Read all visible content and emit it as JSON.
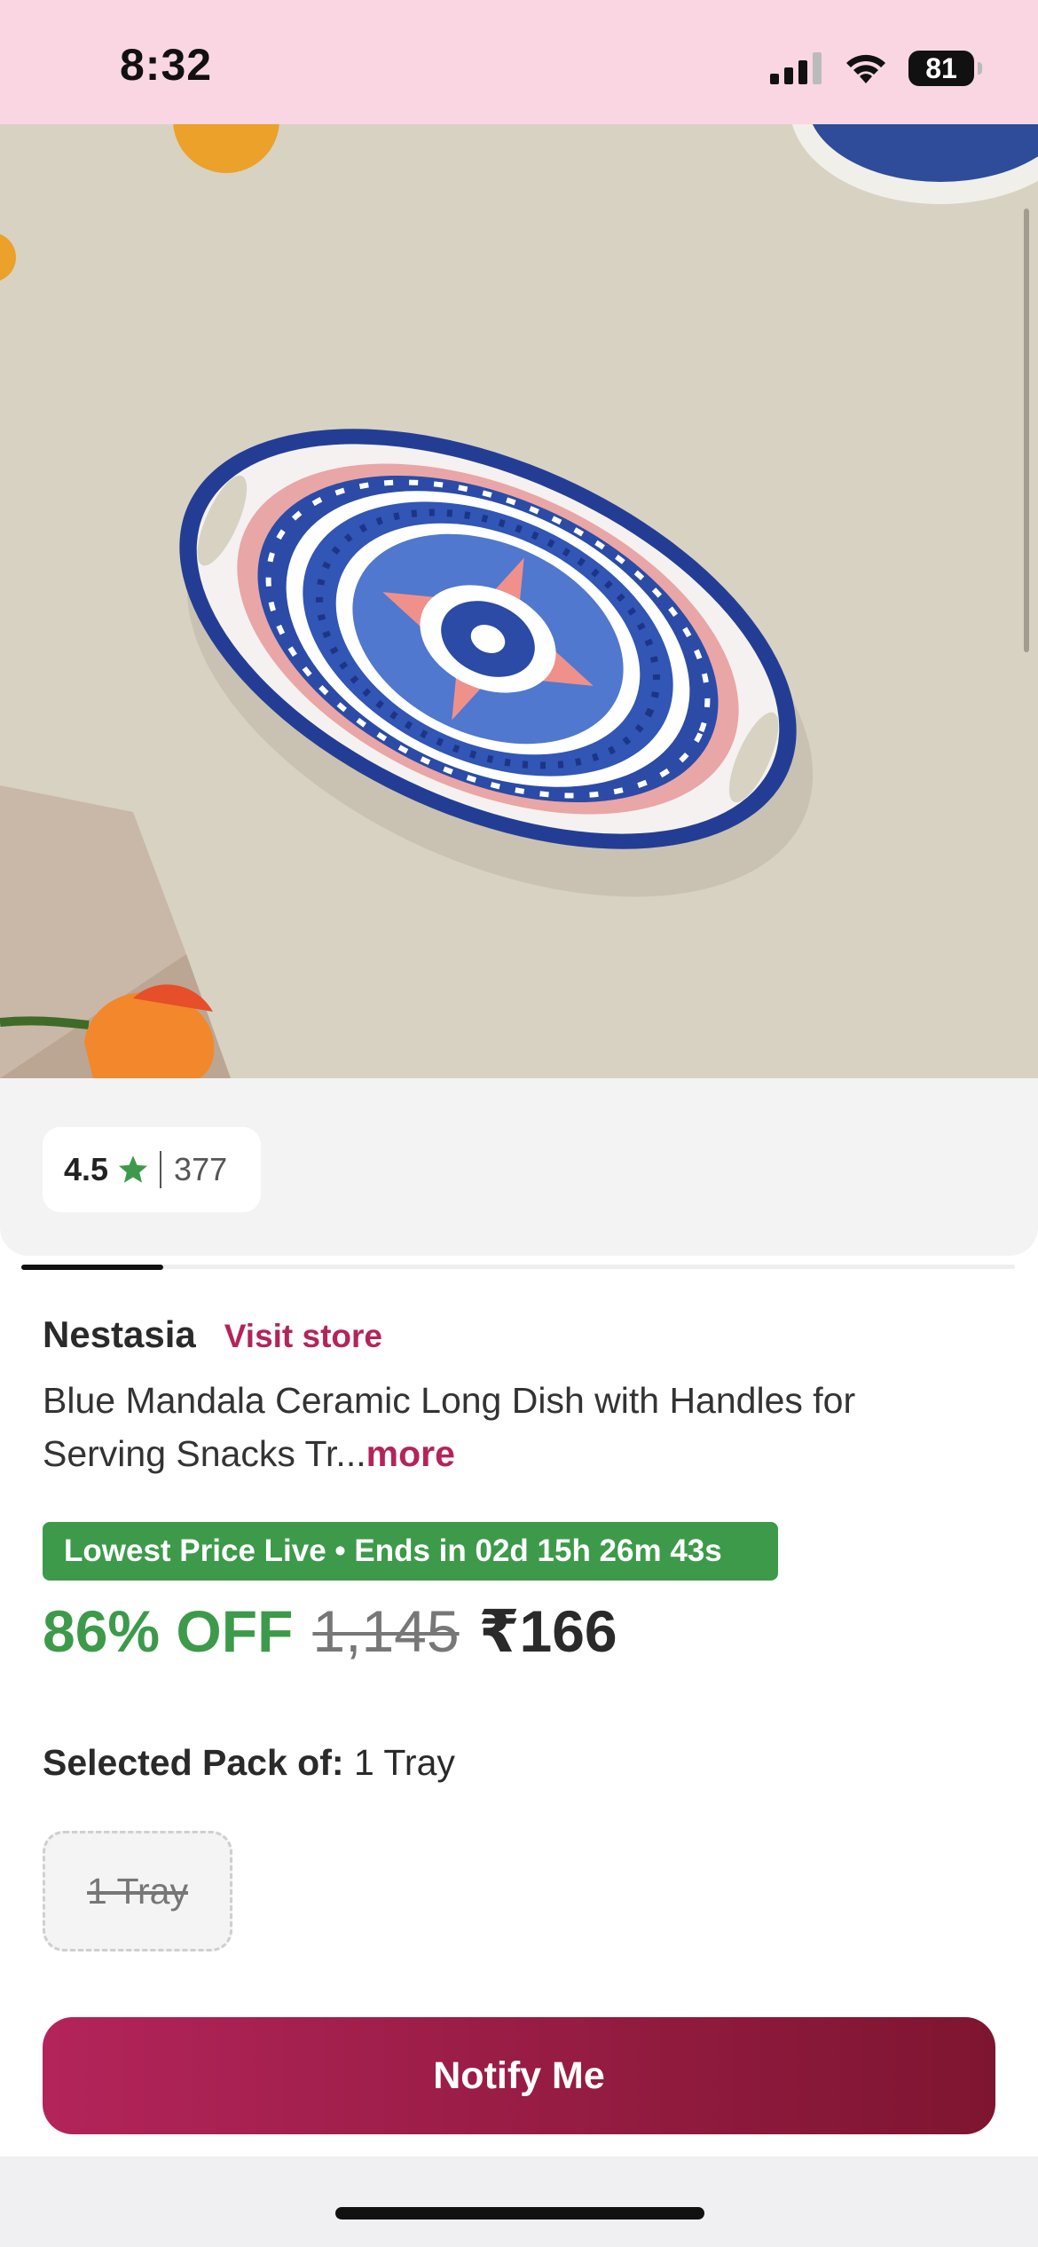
{
  "status_bar": {
    "time": "8:32",
    "battery": "81",
    "icons": [
      "signal-icon",
      "wifi-icon",
      "battery-icon"
    ]
  },
  "product_image": {
    "description_icon": "product-photo"
  },
  "rating": {
    "value": "4.5",
    "count": "377",
    "star_color": "#3d9a4a"
  },
  "brand": {
    "name": "Nestasia",
    "visit_store": "Visit store"
  },
  "product": {
    "title": "Blue Mandala Ceramic Long Dish with Handles for Serving Snacks Tr...",
    "more": "more"
  },
  "deal": {
    "banner": "Lowest Price Live • Ends in 02d 15h 26m 43s",
    "color": "#3d9a4a"
  },
  "pricing": {
    "discount": "86% OFF",
    "mrp": "1,145",
    "price": "₹166"
  },
  "pack": {
    "label": "Selected Pack of:",
    "value": "1 Tray",
    "option": "1 Tray"
  },
  "cta": {
    "label": "Notify Me",
    "color": "#b3245a"
  }
}
